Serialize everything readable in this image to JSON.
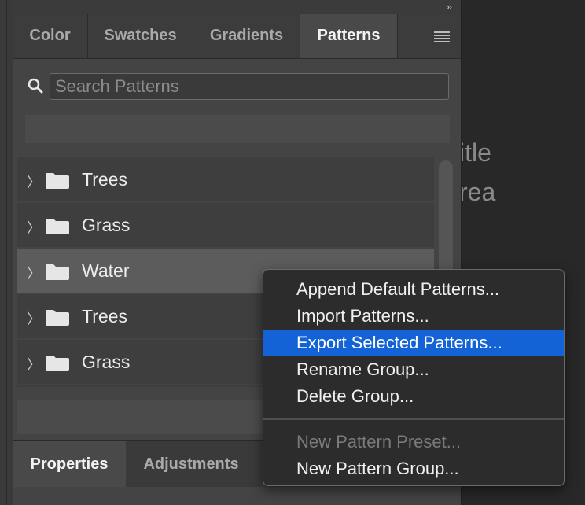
{
  "document": {
    "text_line1": "itle",
    "text_line2": "rea"
  },
  "panel": {
    "collapse_icon": "»",
    "tabs": [
      {
        "label": "Color",
        "active": false
      },
      {
        "label": "Swatches",
        "active": false
      },
      {
        "label": "Gradients",
        "active": false
      },
      {
        "label": "Patterns",
        "active": true
      }
    ],
    "menu_icon": "hamburger-icon",
    "search": {
      "placeholder": "Search Patterns",
      "value": ""
    },
    "groups": [
      {
        "label": "Trees",
        "selected": false
      },
      {
        "label": "Grass",
        "selected": false
      },
      {
        "label": "Water",
        "selected": true
      },
      {
        "label": "Trees",
        "selected": false
      },
      {
        "label": "Grass",
        "selected": false
      }
    ]
  },
  "bottom_panel": {
    "tabs": [
      {
        "label": "Properties",
        "active": true
      },
      {
        "label": "Adjustments",
        "active": false
      }
    ]
  },
  "context_menu": {
    "items": [
      {
        "label": "Append Default Patterns...",
        "state": "normal"
      },
      {
        "label": "Import Patterns...",
        "state": "normal"
      },
      {
        "label": "Export Selected Patterns...",
        "state": "highlighted"
      },
      {
        "label": "Rename Group...",
        "state": "normal"
      },
      {
        "label": "Delete Group...",
        "state": "normal"
      },
      {
        "label": "New Pattern Preset...",
        "state": "disabled"
      },
      {
        "label": "New Pattern Group...",
        "state": "normal"
      }
    ]
  },
  "colors": {
    "highlight": "#1463d6",
    "panel_bg": "#444444",
    "selected_row": "#5c5c5c"
  }
}
